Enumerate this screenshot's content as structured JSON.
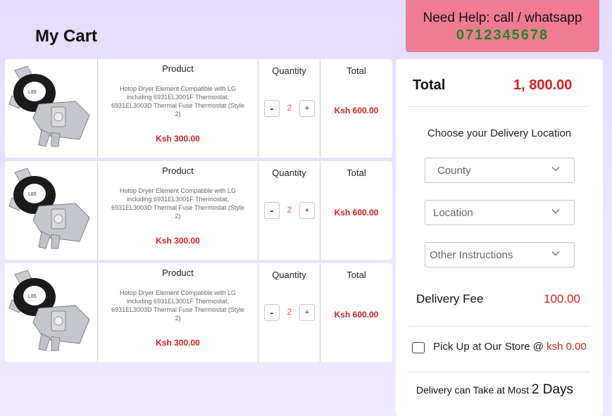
{
  "page_title": "My Cart",
  "help": {
    "line1": "Need Help: call / whatsapp",
    "phone": "0712345678"
  },
  "cart": {
    "items": [
      {
        "product_header": "Product",
        "description": "Hotop Dryer Element Compatible with LG including 6931EL3001F Thermostat, 6931EL3003D Thermal Fuse Thermostat (Style 2)",
        "unit_price": "Ksh 300.00",
        "quantity_header": "Quantity",
        "quantity": "2",
        "minus": "-",
        "plus": "+",
        "total_header": "Total",
        "total": "Ksh 600.00"
      },
      {
        "product_header": "Product",
        "description": "Hotop Dryer Element Compatible with LG including 6931EL3001F Thermostat, 6931EL3003D Thermal Fuse Thermostat (Style 2)",
        "unit_price": "Ksh 300.00",
        "quantity_header": "Quantity",
        "quantity": "2",
        "minus": "-",
        "plus": "+",
        "total_header": "Total",
        "total": "Ksh 600.00"
      },
      {
        "product_header": "Product",
        "description": "Hotop Dryer Element Compatible with LG including 6931EL3001F Thermostat, 6931EL3003D Thermal Fuse Thermostat (Style 2)",
        "unit_price": "Ksh 300.00",
        "quantity_header": "Quantity",
        "quantity": "2",
        "minus": "-",
        "plus": "+",
        "total_header": "Total",
        "total": "Ksh 600.00"
      }
    ]
  },
  "summary": {
    "total_label": "Total",
    "total_value": "1, 800.00",
    "choose_location": "Choose your Delivery Location",
    "county_placeholder": "County",
    "location_placeholder": "Location",
    "instructions_placeholder": "Other Instructions",
    "delivery_fee_label": "Delivery Fee",
    "delivery_fee_value": "100.00",
    "pickup_label": "Pick Up at Our Store @",
    "pickup_price": "ksh 0.00",
    "delivery_time_label": "Delivery can Take at Most",
    "delivery_time_value": "2 Days"
  },
  "colors": {
    "accent_red": "#d42020",
    "help_bg": "#f07c93",
    "phone_green": "#1b8a1b",
    "page_bg": "#e6dcff"
  }
}
